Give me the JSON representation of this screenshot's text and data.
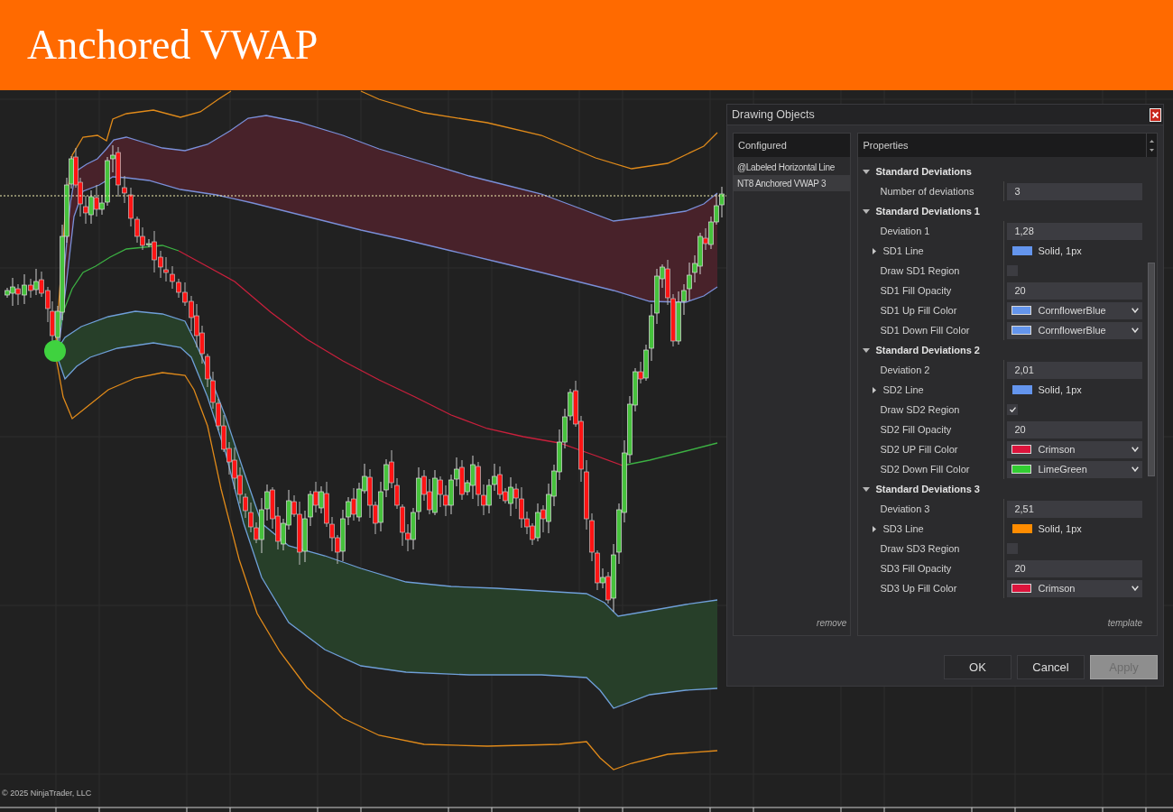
{
  "header": {
    "title": "Anchored VWAP"
  },
  "chart": {
    "copyright": "© 2025 NinjaTrader, LLC"
  },
  "dialog": {
    "title": "Drawing Objects",
    "configured": {
      "header": "Configured",
      "items": [
        {
          "label": "@Labeled Horizontal Line",
          "selected": false
        },
        {
          "label": "NT8 Anchored VWAP 3",
          "selected": true
        }
      ],
      "remove_link": "remove"
    },
    "properties": {
      "header": "Properties",
      "template_link": "template",
      "rows": [
        {
          "kind": "category",
          "label": "Standard Deviations",
          "expanded": true
        },
        {
          "kind": "text",
          "label": "Number of deviations",
          "value": "3"
        },
        {
          "kind": "category",
          "label": "Standard Deviations 1",
          "expanded": true
        },
        {
          "kind": "text",
          "label": "Deviation 1",
          "value": "1,28"
        },
        {
          "kind": "line",
          "label": "SD1 Line",
          "color": "#6495ed",
          "value": "Solid, 1px",
          "expanded": false
        },
        {
          "kind": "checkbox",
          "label": "Draw SD1 Region",
          "checked": false
        },
        {
          "kind": "text",
          "label": "SD1 Fill Opacity",
          "value": "20"
        },
        {
          "kind": "color",
          "label": "SD1 Up Fill Color",
          "color": "#6495ed",
          "value": "CornflowerBlue"
        },
        {
          "kind": "color",
          "label": "SD1 Down Fill Color",
          "color": "#6495ed",
          "value": "CornflowerBlue"
        },
        {
          "kind": "category",
          "label": "Standard Deviations 2",
          "expanded": true
        },
        {
          "kind": "text",
          "label": "Deviation 2",
          "value": "2,01"
        },
        {
          "kind": "line",
          "label": "SD2 Line",
          "color": "#6495ed",
          "value": "Solid, 1px",
          "expanded": false
        },
        {
          "kind": "checkbox",
          "label": "Draw SD2 Region",
          "checked": true
        },
        {
          "kind": "text",
          "label": "SD2 Fill Opacity",
          "value": "20"
        },
        {
          "kind": "color",
          "label": "SD2 UP Fill Color",
          "color": "#dc143c",
          "value": "Crimson"
        },
        {
          "kind": "color",
          "label": "SD2 Down Fill Color",
          "color": "#32cd32",
          "value": "LimeGreen"
        },
        {
          "kind": "category",
          "label": "Standard Deviations 3",
          "expanded": true
        },
        {
          "kind": "text",
          "label": "Deviation 3",
          "value": "2,51"
        },
        {
          "kind": "line",
          "label": "SD3 Line",
          "color": "#ff8c00",
          "value": "Solid, 1px",
          "expanded": false
        },
        {
          "kind": "checkbox",
          "label": "Draw SD3 Region",
          "checked": false
        },
        {
          "kind": "text",
          "label": "SD3 Fill Opacity",
          "value": "20"
        },
        {
          "kind": "color",
          "label": "SD3 Up Fill Color",
          "color": "#dc143c",
          "value": "Crimson"
        }
      ]
    },
    "buttons": [
      {
        "label": "OK",
        "disabled": false
      },
      {
        "label": "Cancel",
        "disabled": false
      },
      {
        "label": "Apply",
        "disabled": true
      }
    ]
  }
}
